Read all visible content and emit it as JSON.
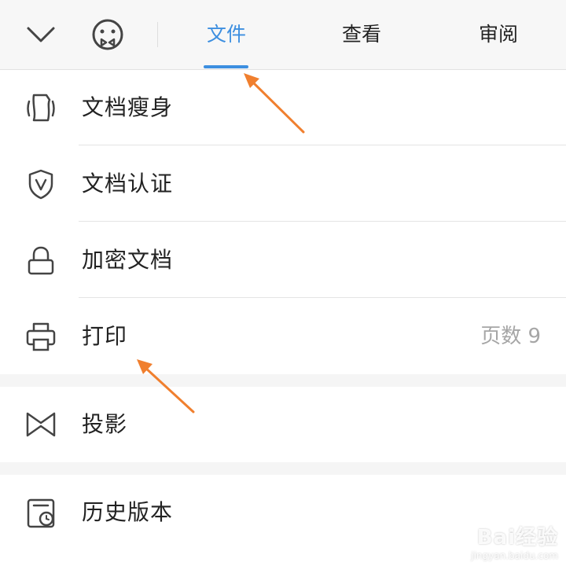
{
  "topbar": {
    "tabs": [
      {
        "label": "文件",
        "active": true
      },
      {
        "label": "查看",
        "active": false
      },
      {
        "label": "审阅",
        "active": false
      }
    ]
  },
  "menu": {
    "items": [
      {
        "icon": "document-slim-icon",
        "label": "文档瘦身"
      },
      {
        "icon": "shield-v-icon",
        "label": "文档认证"
      },
      {
        "icon": "lock-icon",
        "label": "加密文档"
      },
      {
        "icon": "printer-icon",
        "label": "打印",
        "value": "页数 9"
      },
      {
        "icon": "projection-icon",
        "label": "投影"
      },
      {
        "icon": "history-icon",
        "label": "历史版本"
      }
    ]
  },
  "watermark": {
    "logo": "Bai经验",
    "url": "jingyan.baidu.com"
  },
  "colors": {
    "accent": "#3d8fe0",
    "annotation": "#f07f2e"
  }
}
